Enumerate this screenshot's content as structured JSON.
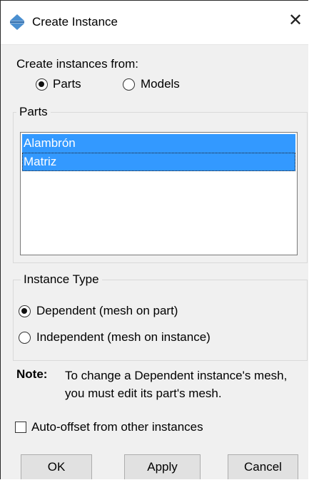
{
  "window": {
    "title": "Create Instance",
    "title_icon": "abaqus-compass-icon",
    "close_label": "✕"
  },
  "source": {
    "label": "Create instances from:",
    "options": [
      {
        "label": "Parts",
        "selected": true
      },
      {
        "label": "Models",
        "selected": false
      }
    ]
  },
  "parts": {
    "legend": "Parts",
    "items": [
      {
        "label": "Alambrón",
        "selected": true
      },
      {
        "label": "Matriz",
        "selected": true,
        "focused": true
      }
    ]
  },
  "instance_type": {
    "legend": "Instance Type",
    "options": [
      {
        "label": "Dependent (mesh on part)",
        "selected": true
      },
      {
        "label": "Independent (mesh on instance)",
        "selected": false
      }
    ]
  },
  "note": {
    "label": "Note:",
    "text": "To change a Dependent instance's mesh, you must edit its part's mesh."
  },
  "auto_offset": {
    "label": "Auto-offset from other instances",
    "checked": false
  },
  "buttons": {
    "ok": "OK",
    "apply": "Apply",
    "cancel": "Cancel"
  },
  "colors": {
    "selection": "#3399ff",
    "dialog_bg": "#f0f0f0",
    "title_bg": "#ffffff",
    "button_bg": "#e1e1e1"
  }
}
